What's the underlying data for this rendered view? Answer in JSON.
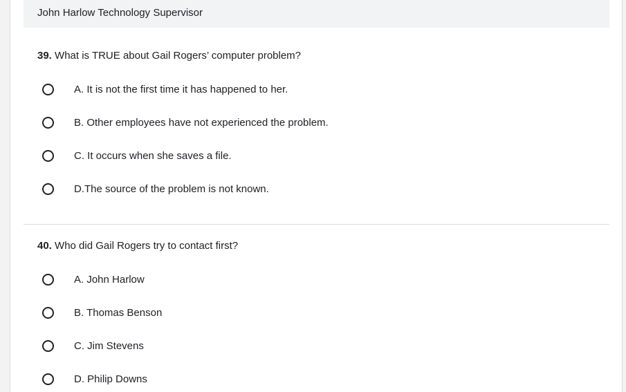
{
  "previous_option": {
    "label": "John Harlow Technology Supervisor"
  },
  "questions": [
    {
      "number": "39.",
      "text": "What is TRUE about Gail Rogers’ computer problem?",
      "options": [
        "A. It is not the first time it has happened to her.",
        "B. Other employees have not experienced the problem.",
        "C. It occurs when she saves a file.",
        "D.The source of the problem is not known."
      ]
    },
    {
      "number": "40.",
      "text": "Who did Gail Rogers try to contact first?",
      "options": [
        "A. John Harlow",
        "B. Thomas Benson",
        "C. Jim Stevens",
        "D. Philip Downs"
      ]
    }
  ]
}
